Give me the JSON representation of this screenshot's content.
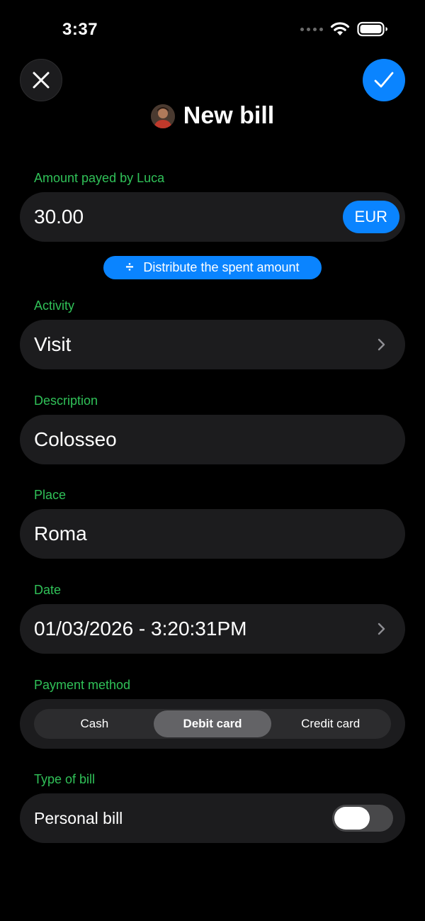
{
  "status_bar": {
    "time": "3:37"
  },
  "header": {
    "title": "New bill",
    "close_icon": "xmark-icon",
    "confirm_icon": "checkmark-icon"
  },
  "amount": {
    "label": "Amount payed by Luca",
    "value": "30.00",
    "currency": "EUR"
  },
  "distribute": {
    "icon": "divide-icon",
    "label": "Distribute the spent amount"
  },
  "activity": {
    "label": "Activity",
    "value": "Visit"
  },
  "description": {
    "label": "Description",
    "value": "Colosseo"
  },
  "place": {
    "label": "Place",
    "value": "Roma"
  },
  "date": {
    "label": "Date",
    "value": "01/03/2026 - 3:20:31PM"
  },
  "payment_method": {
    "label": "Payment method",
    "options": [
      "Cash",
      "Debit card",
      "Credit card"
    ],
    "selected": "Debit card"
  },
  "bill_type": {
    "label": "Type of bill",
    "option_label": "Personal bill",
    "enabled": false
  },
  "colors": {
    "accent": "#0a84ff",
    "label_green": "#30c158",
    "field_bg": "#1c1c1e",
    "background": "#000000"
  }
}
